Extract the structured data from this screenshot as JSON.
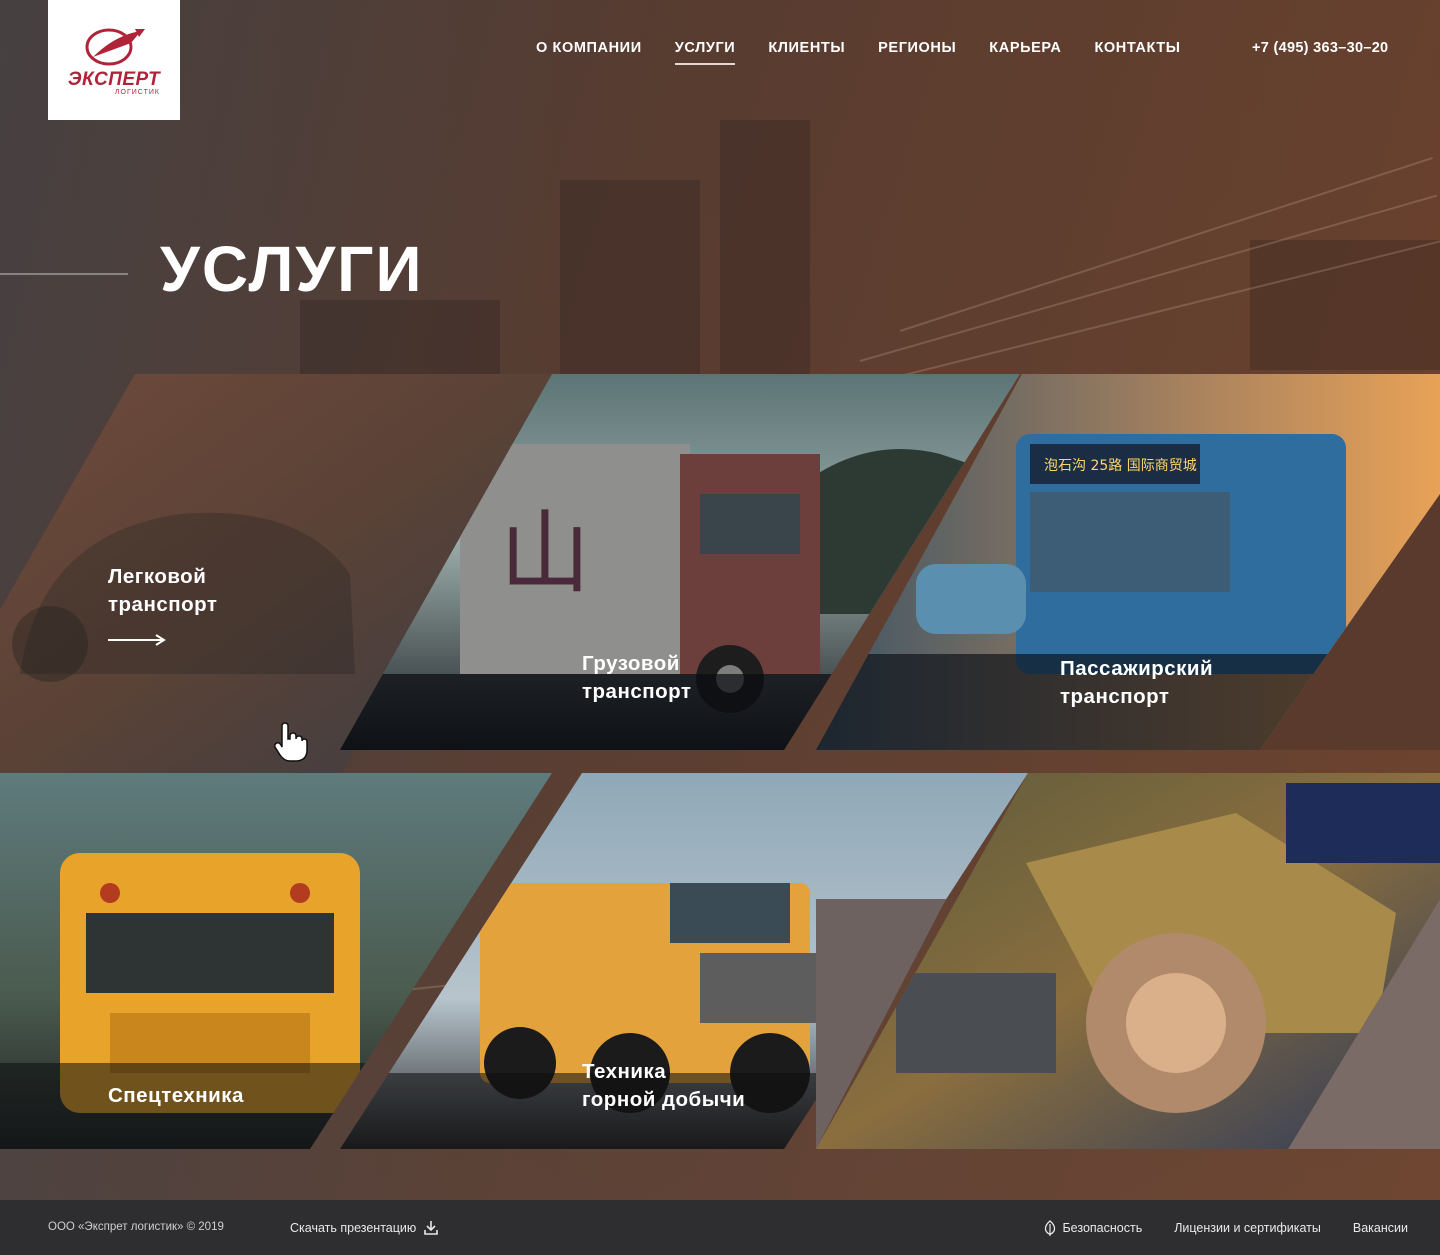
{
  "brand": {
    "name": "ЭКСПЕРТ",
    "subtitle": "ЛОГИСТИК",
    "color": "#b0243a"
  },
  "nav": {
    "items": [
      {
        "label": "О КОМПАНИИ",
        "active": false
      },
      {
        "label": "УСЛУГИ",
        "active": true
      },
      {
        "label": "КЛИЕНТЫ",
        "active": false
      },
      {
        "label": "РЕГИОНЫ",
        "active": false
      },
      {
        "label": "КАРЬЕРА",
        "active": false
      },
      {
        "label": "КОНТАКТЫ",
        "active": false
      }
    ],
    "phone": "+7 (495) 363–30–20"
  },
  "page": {
    "title": "УСЛУГИ"
  },
  "services": [
    {
      "label": "Легковой\nтранспорт",
      "active": true,
      "has_arrow": true
    },
    {
      "label": "Грузовой\nтранспорт",
      "active": false,
      "has_arrow": false
    },
    {
      "label": "Пассажирский\nтранспорт",
      "active": false,
      "has_arrow": false
    },
    {
      "label": "Спецтехника",
      "active": false,
      "has_arrow": false
    },
    {
      "label": "Техника\nгорной добычи",
      "active": false,
      "has_arrow": false
    },
    {
      "label": "",
      "active": false,
      "has_arrow": false
    }
  ],
  "icons": {
    "download": "download-icon",
    "security": "leaf-icon",
    "arrow": "arrow-right-icon",
    "cursor": "hand-cursor-icon"
  },
  "footer": {
    "copyright": "ООО «Экспрет логистик» © 2019",
    "download_label": "Скачать презентацию",
    "links": [
      {
        "label": "Безопасность",
        "icon": "leaf-icon"
      },
      {
        "label": "Лицензии и сертификаты",
        "icon": ""
      },
      {
        "label": "Вакансии",
        "icon": ""
      }
    ]
  }
}
